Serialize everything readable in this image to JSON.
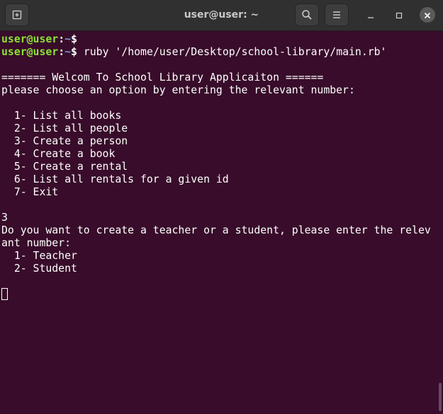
{
  "window": {
    "title": "user@user: ~",
    "icons": {
      "new_tab": "new-tab-icon",
      "search": "search-icon",
      "menu": "hamburger-menu-icon",
      "minimize": "minimize-icon",
      "maximize": "maximize-icon",
      "close": "close-icon"
    },
    "colors": {
      "terminal_bg": "#380c2a",
      "prompt_user": "#8ae234",
      "prompt_path": "#729fcf",
      "text": "#ffffff"
    }
  },
  "terminal": {
    "prompts": [
      {
        "user": "user@user",
        "sep": ":",
        "path": "~",
        "symbol": "$",
        "command": ""
      },
      {
        "user": "user@user",
        "sep": ":",
        "path": "~",
        "symbol": "$",
        "command": " ruby '/home/user/Desktop/school-library/main.rb'"
      }
    ],
    "output": [
      "",
      "======= Welcom To School Library Applicaiton ======",
      "please choose an option by entering the relevant number:",
      "",
      "  1- List all books",
      "  2- List all people",
      "  3- Create a person",
      "  4- Create a book",
      "  5- Create a rental",
      "  6- List all rentals for a given id",
      "  7- Exit",
      "",
      "3",
      "Do you want to create a teacher or a student, please enter the relev",
      "ant number:",
      "  1- Teacher",
      "  2- Student",
      ""
    ]
  }
}
